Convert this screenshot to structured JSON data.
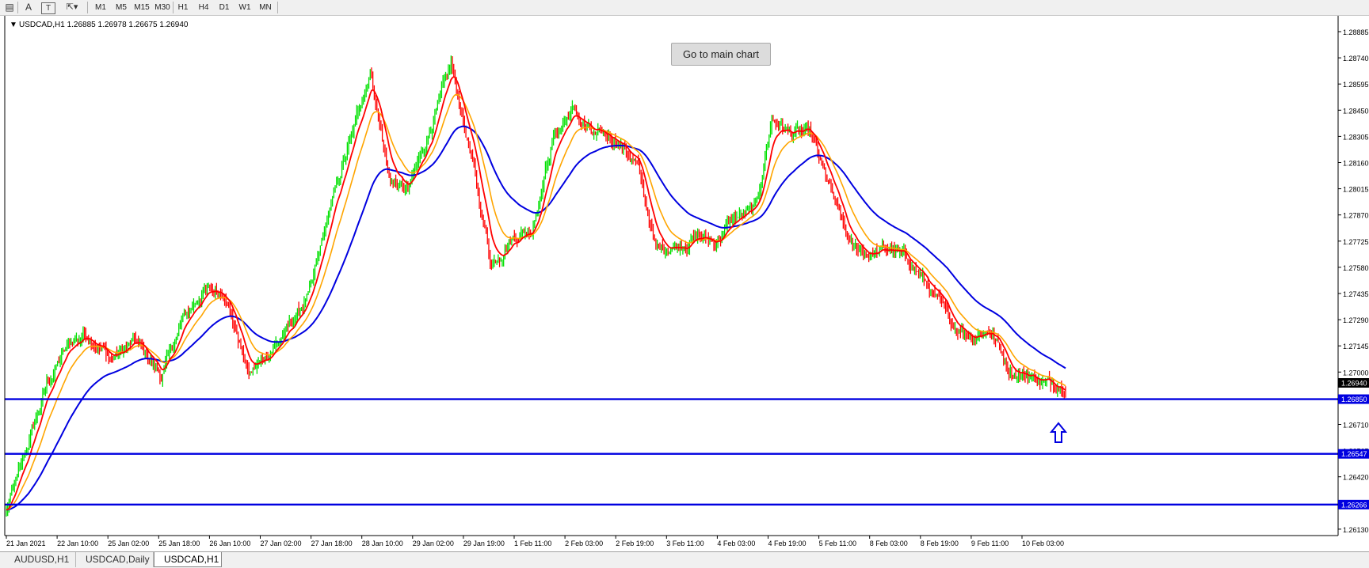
{
  "toolbar": {
    "tools": [
      {
        "icon": "grid-lines-icon",
        "glyph": "▤"
      },
      {
        "icon": "text-tool-icon",
        "glyph": "A"
      },
      {
        "icon": "text-label-tool-icon",
        "glyph": "T"
      },
      {
        "icon": "arrows-tool-icon",
        "glyph": "⇱▾"
      }
    ],
    "timeframes": [
      "M1",
      "M5",
      "M15",
      "M30",
      "H1",
      "H4",
      "D1",
      "W1",
      "MN"
    ]
  },
  "chart": {
    "header": "USDCAD,H1  1.26885 1.26978 1.26675 1.26940",
    "main_button": "Go to main chart",
    "price_ticks": [
      "1.28885",
      "1.28740",
      "1.28595",
      "1.28450",
      "1.28305",
      "1.28160",
      "1.28015",
      "1.27870",
      "1.27725",
      "1.27580",
      "1.27435",
      "1.27290",
      "1.27145",
      "1.27000",
      "1.26855",
      "1.26710",
      "1.26565",
      "1.26420",
      "1.26275",
      "1.26130"
    ],
    "time_labels": [
      "21 Jan 2021",
      "22 Jan 10:00",
      "25 Jan 02:00",
      "25 Jan 18:00",
      "26 Jan 10:00",
      "27 Jan 02:00",
      "27 Jan 18:00",
      "28 Jan 10:00",
      "29 Jan 02:00",
      "29 Jan 19:00",
      "1 Feb 11:00",
      "2 Feb 03:00",
      "2 Feb 19:00",
      "3 Feb 11:00",
      "4 Feb 03:00",
      "4 Feb 19:00",
      "5 Feb 11:00",
      "8 Feb 03:00",
      "8 Feb 19:00",
      "9 Feb 11:00",
      "10 Feb 03:00"
    ],
    "current_price": "1.26940",
    "levels": [
      {
        "price": 1.2685,
        "label": "1.26850"
      },
      {
        "price": 1.26547,
        "label": "1.26547"
      },
      {
        "price": 1.26266,
        "label": "1.26266"
      }
    ],
    "ma_colors": {
      "fast": "#ff0000",
      "mid": "#ffa500",
      "slow": "#0000e0"
    },
    "candle_colors": {
      "up": "#00e000",
      "down": "#ff0000"
    },
    "level_color": "#0000e0",
    "annotation": "up-arrow-icon"
  },
  "tabs": [
    {
      "label": "AUDUSD,H1",
      "active": false
    },
    {
      "label": "USDCAD,Daily",
      "active": false
    },
    {
      "label": "USDCAD,H1",
      "active": true
    }
  ]
}
